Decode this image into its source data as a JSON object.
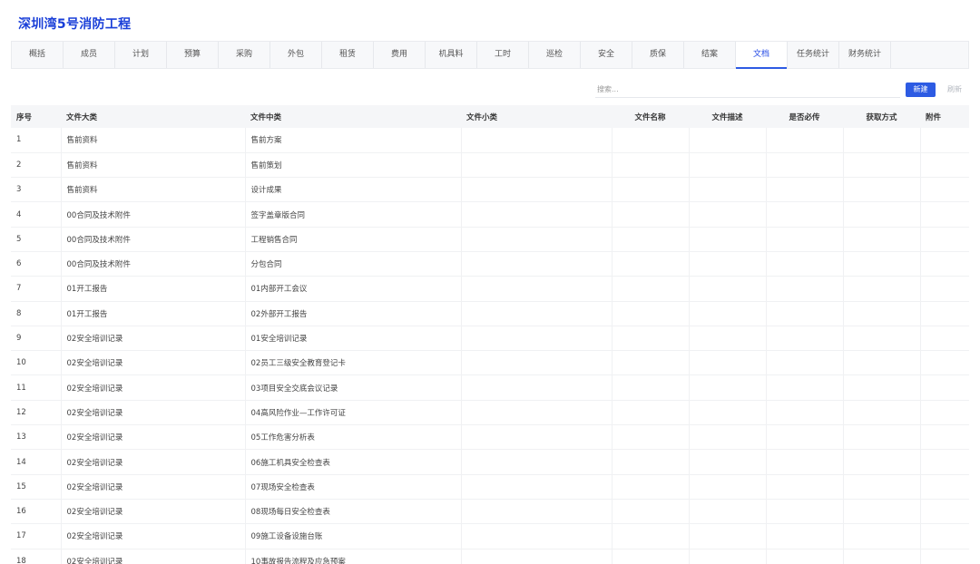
{
  "page": {
    "title": "深圳湾5号消防工程"
  },
  "tabs": [
    {
      "label": "概括"
    },
    {
      "label": "成员"
    },
    {
      "label": "计划"
    },
    {
      "label": "预算"
    },
    {
      "label": "采购"
    },
    {
      "label": "外包"
    },
    {
      "label": "租赁"
    },
    {
      "label": "费用"
    },
    {
      "label": "机具料"
    },
    {
      "label": "工时"
    },
    {
      "label": "巡检"
    },
    {
      "label": "安全"
    },
    {
      "label": "质保"
    },
    {
      "label": "结案"
    },
    {
      "label": "文档"
    },
    {
      "label": "任务统计"
    },
    {
      "label": "财务统计"
    }
  ],
  "active_tab": "文档",
  "toolbar": {
    "search_placeholder": "搜索...",
    "new_label": "新建",
    "refresh_label": "刷新"
  },
  "table": {
    "columns": [
      "序号",
      "文件大类",
      "文件中类",
      "文件小类",
      "文件名称",
      "文件描述",
      "是否必传",
      "获取方式",
      "附件"
    ],
    "rows": [
      [
        "1",
        "售前资料",
        "售前方案",
        "",
        "",
        "",
        "",
        "",
        ""
      ],
      [
        "2",
        "售前资料",
        "售前策划",
        "",
        "",
        "",
        "",
        "",
        ""
      ],
      [
        "3",
        "售前资料",
        "设计成果",
        "",
        "",
        "",
        "",
        "",
        ""
      ],
      [
        "4",
        "00合同及技术附件",
        "签字盖章版合同",
        "",
        "",
        "",
        "",
        "",
        ""
      ],
      [
        "5",
        "00合同及技术附件",
        "工程销售合同",
        "",
        "",
        "",
        "",
        "",
        ""
      ],
      [
        "6",
        "00合同及技术附件",
        "分包合同",
        "",
        "",
        "",
        "",
        "",
        ""
      ],
      [
        "7",
        "01开工报告",
        "01内部开工会议",
        "",
        "",
        "",
        "",
        "",
        ""
      ],
      [
        "8",
        "01开工报告",
        "02外部开工报告",
        "",
        "",
        "",
        "",
        "",
        ""
      ],
      [
        "9",
        "02安全培训记录",
        "01安全培训记录",
        "",
        "",
        "",
        "",
        "",
        ""
      ],
      [
        "10",
        "02安全培训记录",
        "02员工三级安全教育登记卡",
        "",
        "",
        "",
        "",
        "",
        ""
      ],
      [
        "11",
        "02安全培训记录",
        "03项目安全交底会议记录",
        "",
        "",
        "",
        "",
        "",
        ""
      ],
      [
        "12",
        "02安全培训记录",
        "04高风险作业—工作许可证",
        "",
        "",
        "",
        "",
        "",
        ""
      ],
      [
        "13",
        "02安全培训记录",
        "05工作危害分析表",
        "",
        "",
        "",
        "",
        "",
        ""
      ],
      [
        "14",
        "02安全培训记录",
        "06施工机具安全检查表",
        "",
        "",
        "",
        "",
        "",
        ""
      ],
      [
        "15",
        "02安全培训记录",
        "07现场安全检查表",
        "",
        "",
        "",
        "",
        "",
        ""
      ],
      [
        "16",
        "02安全培训记录",
        "08现场每日安全检查表",
        "",
        "",
        "",
        "",
        "",
        ""
      ],
      [
        "17",
        "02安全培训记录",
        "09施工设备设施台账",
        "",
        "",
        "",
        "",
        "",
        ""
      ],
      [
        "18",
        "02安全培训记录",
        "10事故报告流程及应急预案",
        "",
        "",
        "",
        "",
        "",
        ""
      ]
    ]
  }
}
